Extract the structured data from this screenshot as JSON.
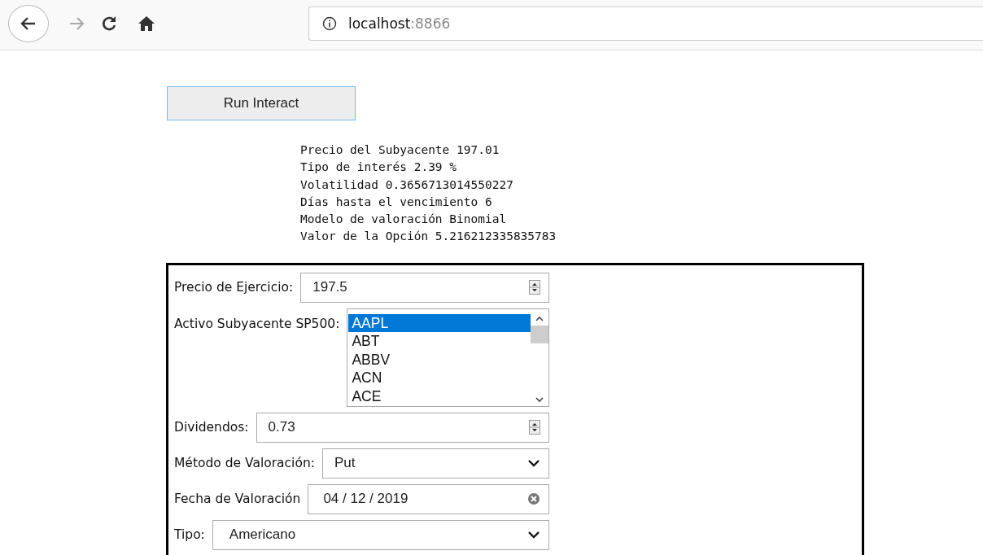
{
  "browser": {
    "url_host": "localhost",
    "url_port": ":8866"
  },
  "run_button": "Run Interact",
  "output_lines": [
    "Precio del Subyacente 197.01",
    "Tipo de interés 2.39 %",
    "Volatilidad 0.3656713014550227",
    "Días hasta el vencimiento 6",
    "Modelo de valoración Binomial",
    "Valor de la Opción 5.216212335835783"
  ],
  "form": [
    {
      "kind": "number",
      "label": "Precio de Ejercicio:",
      "value": "197.5"
    },
    {
      "kind": "listbox",
      "label": "Activo Subyacente SP500:",
      "options": [
        {
          "text": "AAPL",
          "selected": true
        },
        {
          "text": "ABT",
          "selected": false
        },
        {
          "text": "ABBV",
          "selected": false
        },
        {
          "text": "ACN",
          "selected": false
        },
        {
          "text": "ACE",
          "selected": false
        }
      ]
    },
    {
      "kind": "number",
      "label": "Dividendos:",
      "value": "0.73"
    },
    {
      "kind": "select",
      "label": "Método de Valoración:",
      "value": "Put"
    },
    {
      "kind": "date",
      "label": "Fecha de Valoración",
      "value": "04 / 12 / 2019"
    },
    {
      "kind": "select",
      "label": "Tipo:",
      "value": "Americano"
    }
  ]
}
